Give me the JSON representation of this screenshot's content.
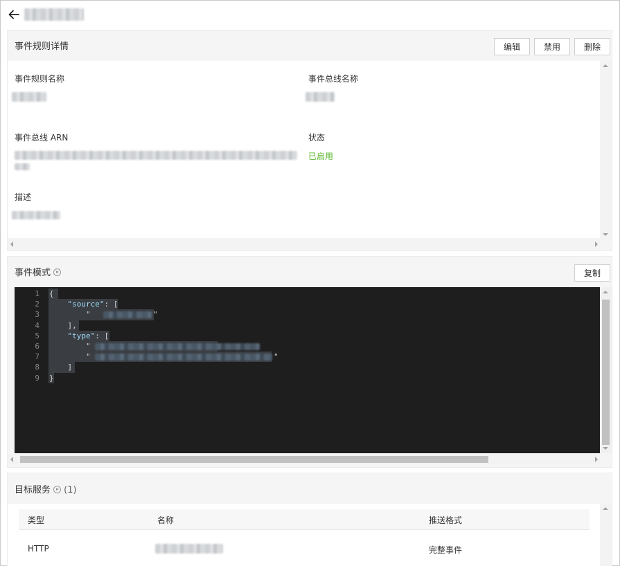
{
  "header": {
    "back_icon": "arrow-left-icon",
    "title_redacted": true
  },
  "details": {
    "title": "事件规则详情",
    "buttons": {
      "edit": "编辑",
      "disable": "禁用",
      "delete": "删除"
    },
    "fields": {
      "rule_name_label": "事件规则名称",
      "bus_name_label": "事件总线名称",
      "bus_arn_label": "事件总线 ARN",
      "status_label": "状态",
      "status_value": "已启用",
      "description_label": "描述"
    }
  },
  "pattern": {
    "title": "事件模式",
    "help_icon": "help-circle-icon",
    "copy_button": "复制",
    "line_numbers": [
      "1",
      "2",
      "3",
      "4",
      "5",
      "6",
      "7",
      "8",
      "9"
    ],
    "lines": [
      "{",
      "    \"source\": [",
      "        \"",
      "    ],",
      "    \"type\": [",
      "        \"",
      "        \"",
      "    ]",
      "}"
    ],
    "keys": {
      "source": "\"source\"",
      "type": "\"type\""
    }
  },
  "targets": {
    "title": "目标服务",
    "help_icon": "help-circle-icon",
    "count": "(1)",
    "columns": {
      "type": "类型",
      "name": "名称",
      "format": "推送格式"
    },
    "rows": [
      {
        "type": "HTTP",
        "format": "完整事件"
      }
    ]
  },
  "colors": {
    "status_enabled": "#5cb82e",
    "editor_bg": "#1e1e1e",
    "json_key": "#9cdcfe"
  }
}
